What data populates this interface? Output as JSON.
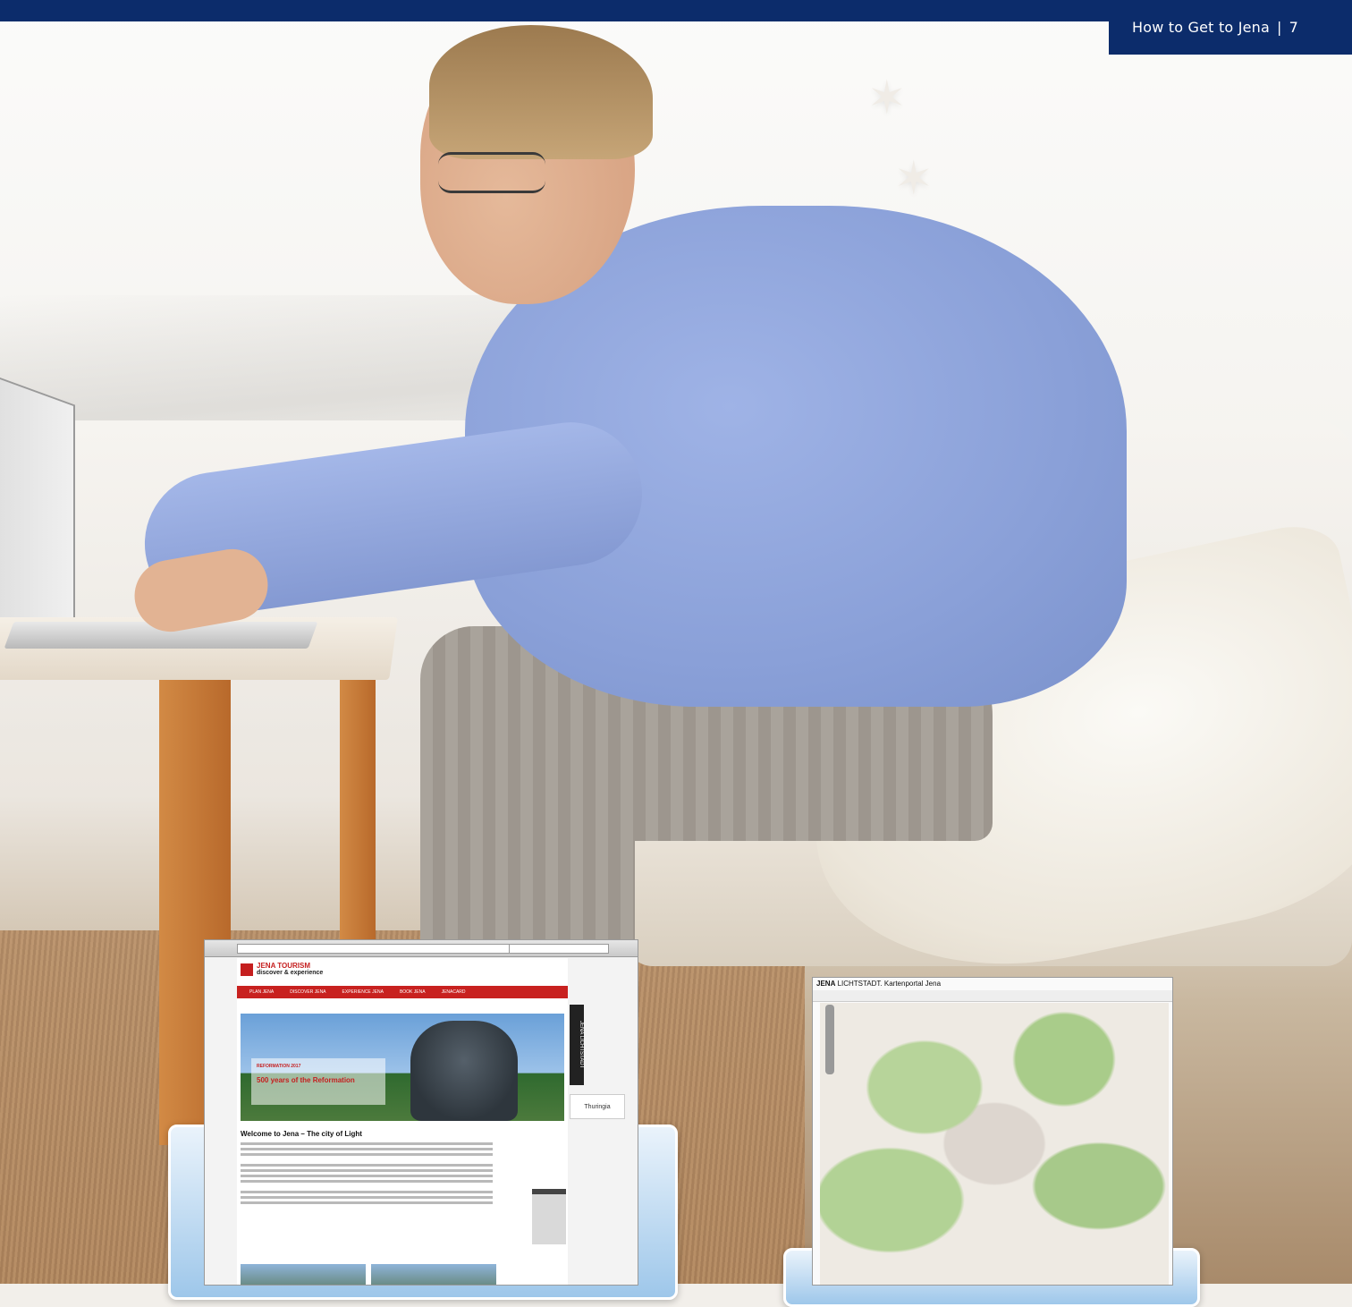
{
  "header": {
    "section_title": "How to Get to Jena",
    "separator": "|",
    "page_number": "7"
  },
  "colors": {
    "brand_blue": "#0c2c6b",
    "jena_red": "#c51f1f"
  },
  "website_screenshot": {
    "logo_line1": "JENA TOURISM",
    "logo_line2": "discover & experience",
    "nav_items": [
      "PLAN JENA",
      "DISCOVER JENA",
      "EXPERIENCE JENA",
      "BOOK JENA",
      "JENACARD"
    ],
    "hero_kicker": "REFORMATION 2017",
    "hero_title": "500 years of the Reformation",
    "heading": "Welcome to Jena – The city of Light",
    "side_badge": "JENA LICHTSTADT",
    "partner_badge": "Thuringia"
  },
  "map_screenshot": {
    "title_bold": "JENA",
    "title_rest": " LICHTSTADT. Kartenportal Jena"
  }
}
